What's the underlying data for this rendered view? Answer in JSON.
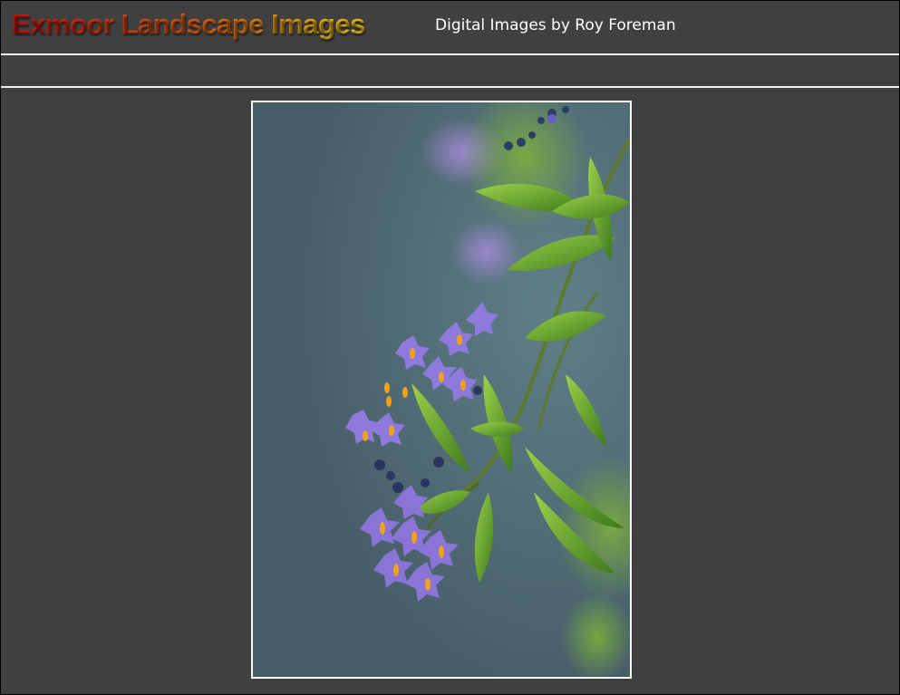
{
  "header": {
    "title": "Exmoor Landscape Images",
    "subtitle": "Digital Images by Roy Foreman"
  },
  "photo": {
    "subject": "photograph of purple flowers with green leaves against a blue-grey background"
  },
  "colors": {
    "background": "#404040",
    "title_gradient_start": "#d4120b",
    "title_gradient_end": "#f9d020",
    "rule": "#f2f2f2",
    "photo_border": "#ffffff"
  }
}
